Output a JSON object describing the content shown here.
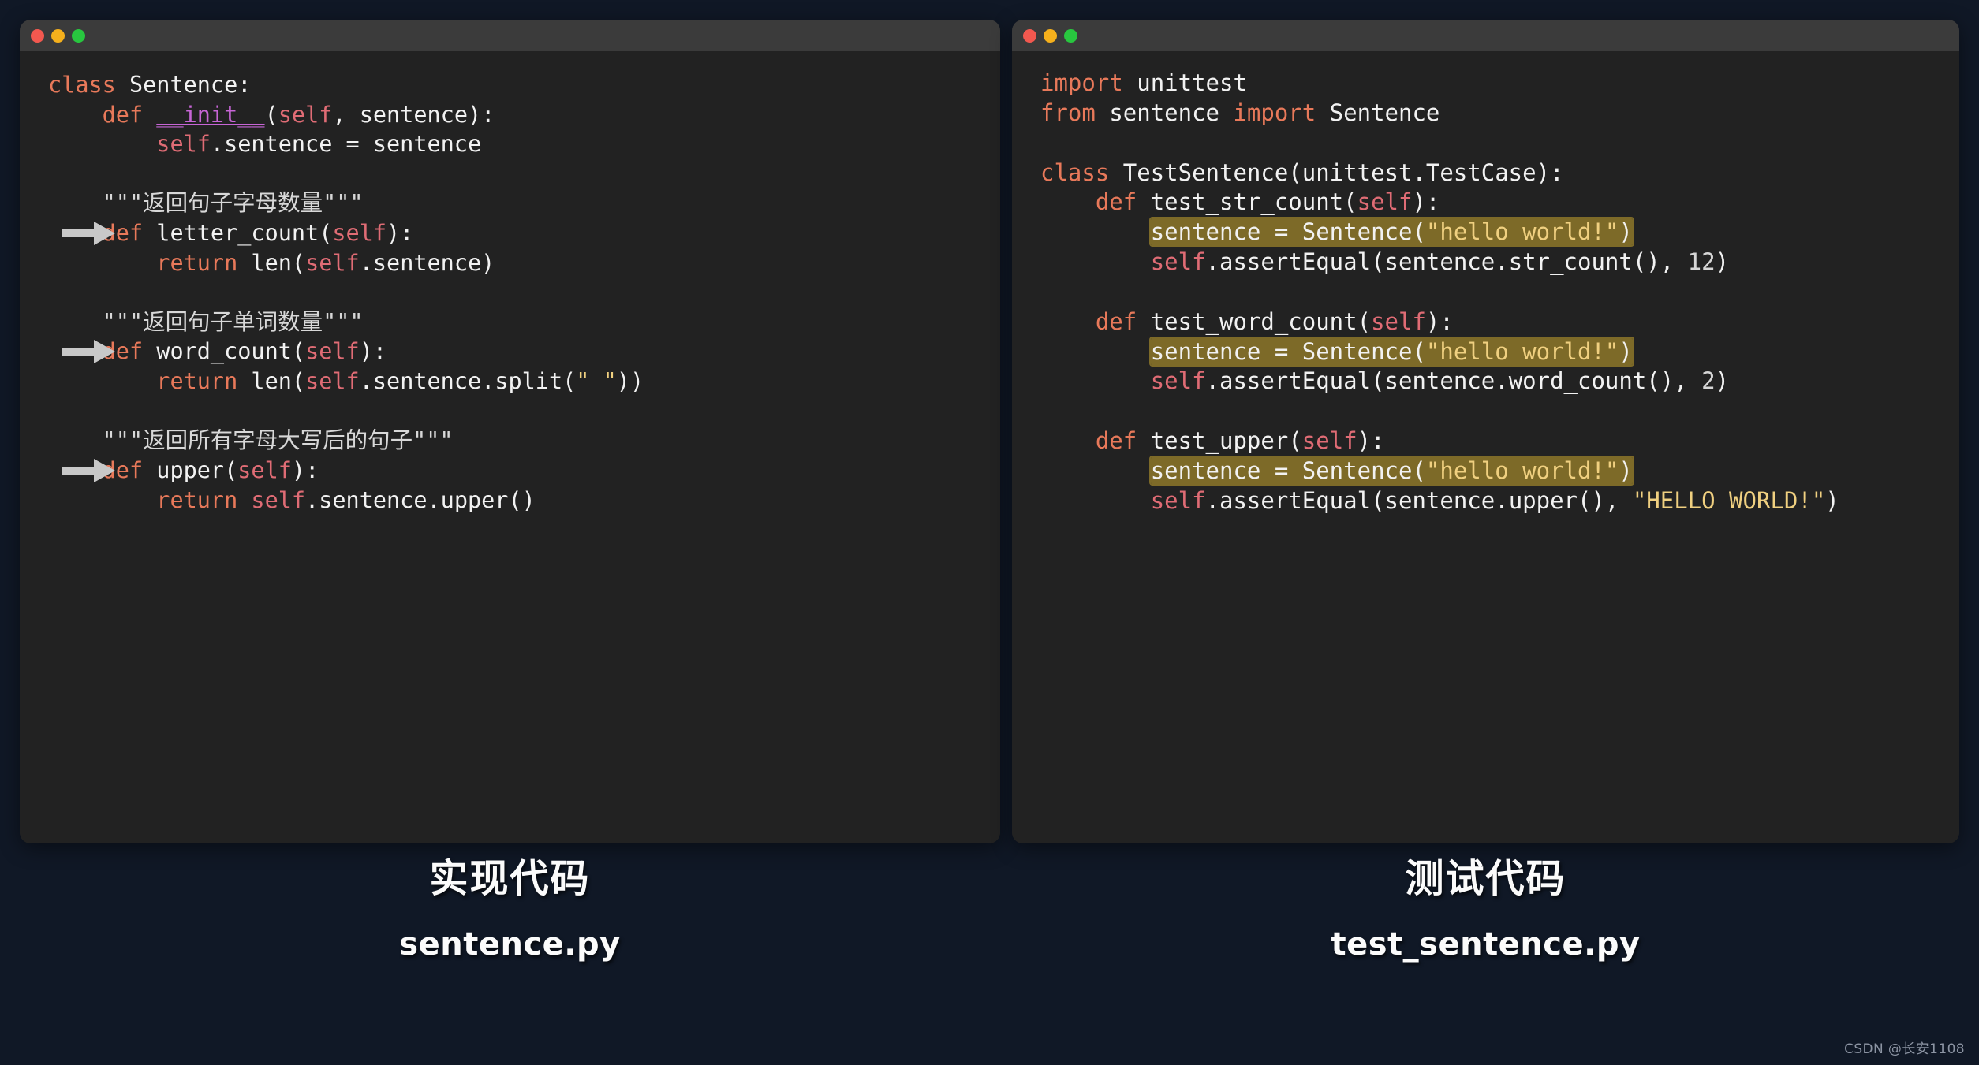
{
  "window_controls": {
    "close_label": "close",
    "minimize_label": "minimize",
    "maximize_label": "maximize",
    "colors": {
      "close": "#f2584f",
      "minimize": "#f5b01c",
      "maximize": "#28c63f"
    }
  },
  "theme": {
    "page_background": "#101826",
    "panel_background": "#222222",
    "titlebar_background": "#3b3b3b",
    "keyword": "#e8795a",
    "self": "#e06c75",
    "dunder": "#c765d6",
    "string": "#f0d080",
    "plain_text": "#f2f2f2",
    "docstring": "#d8d8d8",
    "highlight": "#7d6a28",
    "arrow": "#c8c8c8",
    "caption": "#fbfbfb",
    "watermark": "#8c94a3"
  },
  "left_panel": {
    "lines": [
      {
        "id": "l1",
        "text": "class Sentence:"
      },
      {
        "id": "l2",
        "text": "    def __init__(self, sentence):"
      },
      {
        "id": "l3",
        "text": "        self.sentence = sentence"
      },
      {
        "id": "l4",
        "text": ""
      },
      {
        "id": "l5",
        "text": "    \"\"\"返回句子字母数量\"\"\""
      },
      {
        "id": "l6",
        "text": "    def letter_count(self):",
        "arrow": true
      },
      {
        "id": "l7",
        "text": "        return len(self.sentence)"
      },
      {
        "id": "l8",
        "text": ""
      },
      {
        "id": "l9",
        "text": "    \"\"\"返回句子单词数量\"\"\""
      },
      {
        "id": "l10",
        "text": "    def word_count(self):",
        "arrow": true
      },
      {
        "id": "l11",
        "text": "        return len(self.sentence.split(\" \"))"
      },
      {
        "id": "l12",
        "text": ""
      },
      {
        "id": "l13",
        "text": "    \"\"\"返回所有字母大写后的句子\"\"\""
      },
      {
        "id": "l14",
        "text": "    def upper(self):",
        "arrow": true
      },
      {
        "id": "l15",
        "text": "        return self.sentence.upper()"
      }
    ]
  },
  "right_panel": {
    "lines": [
      {
        "id": "r1",
        "text": "import unittest"
      },
      {
        "id": "r2",
        "text": "from sentence import Sentence"
      },
      {
        "id": "r3",
        "text": ""
      },
      {
        "id": "r4",
        "text": "class TestSentence(unittest.TestCase):"
      },
      {
        "id": "r5",
        "text": "    def test_str_count(self):"
      },
      {
        "id": "r6",
        "text": "        sentence = Sentence(\"hello world!\")",
        "highlight": true
      },
      {
        "id": "r7",
        "text": "        self.assertEqual(sentence.str_count(), 12)"
      },
      {
        "id": "r8",
        "text": ""
      },
      {
        "id": "r9",
        "text": "    def test_word_count(self):"
      },
      {
        "id": "r10",
        "text": "        sentence = Sentence(\"hello world!\")",
        "highlight": true
      },
      {
        "id": "r11",
        "text": "        self.assertEqual(sentence.word_count(), 2)"
      },
      {
        "id": "r12",
        "text": ""
      },
      {
        "id": "r13",
        "text": "    def test_upper(self):"
      },
      {
        "id": "r14",
        "text": "        sentence = Sentence(\"hello world!\")",
        "highlight": true
      },
      {
        "id": "r15",
        "text": "        self.assertEqual(sentence.upper(), \"HELLO WORLD!\")"
      }
    ]
  },
  "captions": {
    "left": {
      "title": "实现代码",
      "file": "sentence.py"
    },
    "right": {
      "title": "测试代码",
      "file": "test_sentence.py"
    }
  },
  "watermark": {
    "text": "CSDN @长安1108"
  }
}
